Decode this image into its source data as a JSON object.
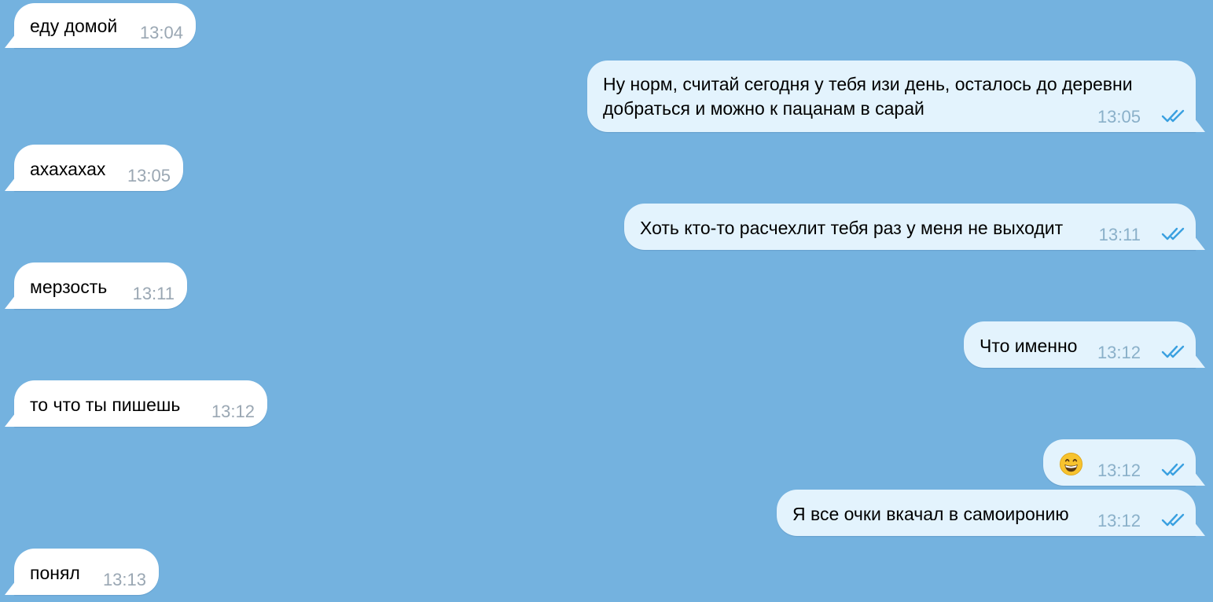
{
  "chat": {
    "background_color": "#74b2df",
    "incoming_bubble_color": "#ffffff",
    "outgoing_bubble_color": "#e3f3fd",
    "read_receipt_color": "#3aa0e0",
    "messages": [
      {
        "direction": "in",
        "text": "еду домой",
        "time": "13:04"
      },
      {
        "direction": "out",
        "text": "Ну норм, считай сегодня у тебя изи день, осталось до деревни\nдобраться и можно к пацанам в сарай",
        "time": "13:05",
        "status": "read"
      },
      {
        "direction": "in",
        "text": "ахахахах",
        "time": "13:05"
      },
      {
        "direction": "out",
        "text": "Хоть кто-то расчехлит тебя раз у меня не выходит",
        "time": "13:11",
        "status": "read"
      },
      {
        "direction": "in",
        "text": "мерзость",
        "time": "13:11"
      },
      {
        "direction": "out",
        "text": "Что именно",
        "time": "13:12",
        "status": "read"
      },
      {
        "direction": "in",
        "text": "то что ты пишешь",
        "time": "13:12"
      },
      {
        "direction": "out",
        "emoji": "grinning-face-icon",
        "time": "13:12",
        "status": "read"
      },
      {
        "direction": "out",
        "text": "Я все очки вкачал в самоиронию",
        "time": "13:12",
        "status": "read"
      },
      {
        "direction": "in",
        "text": "понял",
        "time": "13:13"
      }
    ]
  }
}
